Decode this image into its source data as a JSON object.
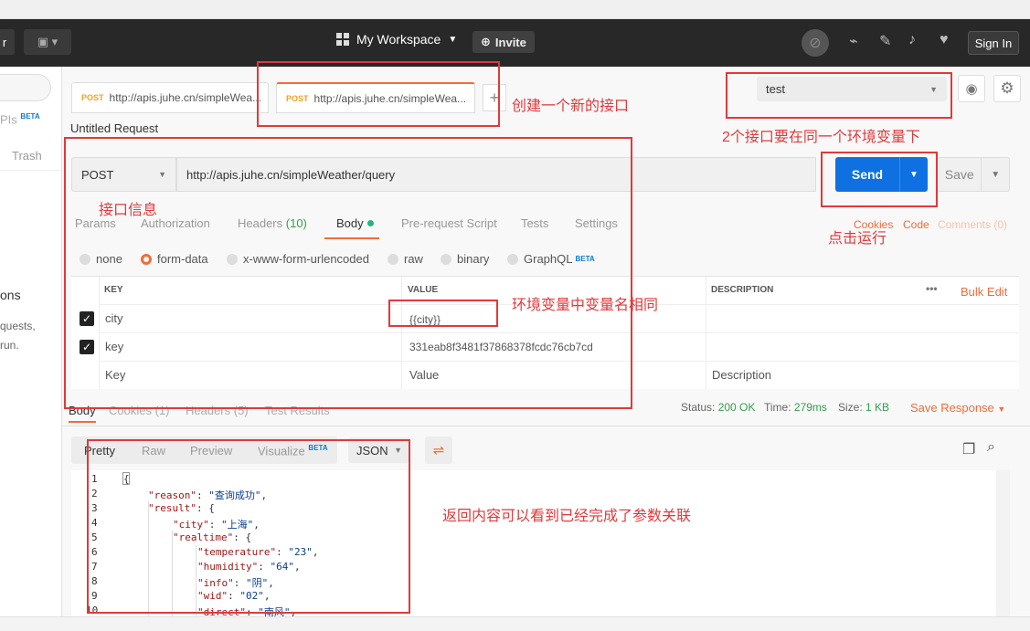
{
  "header": {
    "workspace": "My Workspace",
    "invite": "Invite",
    "sign_in": "Sign In"
  },
  "sidebar": {
    "apis": "PIs",
    "apis_badge": "BETA",
    "trash": "Trash",
    "section_title": "ons",
    "line1": "quests,",
    "line2": "run."
  },
  "tabs": [
    {
      "method": "POST",
      "label": "http://apis.juhe.cn/simpleWea..."
    },
    {
      "method": "POST",
      "label": "http://apis.juhe.cn/simpleWea..."
    }
  ],
  "environment": "test",
  "request": {
    "title": "Untitled Request",
    "method": "POST",
    "url": "http://apis.juhe.cn/simpleWeather/query",
    "send": "Send",
    "save": "Save"
  },
  "request_tabs": {
    "params": "Params",
    "authorization": "Authorization",
    "headers": "Headers",
    "headers_count": "(10)",
    "body": "Body",
    "prerequest": "Pre-request Script",
    "tests": "Tests",
    "settings": "Settings",
    "cookies": "Cookies",
    "code": "Code",
    "comments": "Comments (0)"
  },
  "body_types": {
    "none": "none",
    "form_data": "form-data",
    "urlencoded": "x-www-form-urlencoded",
    "raw": "raw",
    "binary": "binary",
    "graphql": "GraphQL",
    "graphql_badge": "BETA"
  },
  "params_table": {
    "headers": {
      "key": "KEY",
      "value": "VALUE",
      "description": "DESCRIPTION",
      "more": "•••",
      "bulk_edit": "Bulk Edit"
    },
    "rows": [
      {
        "key": "city",
        "value": "{{city}}"
      },
      {
        "key": "key",
        "value": "331eab8f3481f37868378fcdc76cb7cd"
      }
    ],
    "placeholder": {
      "key": "Key",
      "value": "Value",
      "description": "Description"
    }
  },
  "response": {
    "tabs": {
      "body": "Body",
      "cookies": "Cookies (1)",
      "headers": "Headers (5)",
      "test_results": "Test Results"
    },
    "status_label": "Status:",
    "status": "200 OK",
    "time_label": "Time:",
    "time": "279ms",
    "size_label": "Size:",
    "size": "1 KB",
    "save_response": "Save Response",
    "view_tabs": {
      "pretty": "Pretty",
      "raw": "Raw",
      "preview": "Preview",
      "visualize": "Visualize",
      "visualize_badge": "BETA"
    },
    "format": "JSON"
  },
  "code_lines": [
    {
      "n": "1",
      "text": "{"
    },
    {
      "n": "2",
      "key": "\"reason\"",
      "val": "\"查询成功\"",
      "tail": ","
    },
    {
      "n": "3",
      "key": "\"result\"",
      "tail": " {"
    },
    {
      "n": "4",
      "key": "\"city\"",
      "val": "\"上海\"",
      "tail": ","
    },
    {
      "n": "5",
      "key": "\"realtime\"",
      "tail": " {"
    },
    {
      "n": "6",
      "key": "\"temperature\"",
      "val": "\"23\"",
      "tail": ","
    },
    {
      "n": "7",
      "key": "\"humidity\"",
      "val": "\"64\"",
      "tail": ","
    },
    {
      "n": "8",
      "key": "\"info\"",
      "val": "\"阴\"",
      "tail": ","
    },
    {
      "n": "9",
      "key": "\"wid\"",
      "val": "\"02\"",
      "tail": ","
    },
    {
      "n": "10",
      "key": "\"direct\"",
      "val": "\"南风\"",
      "tail": ","
    }
  ],
  "annotations": {
    "new_api": "创建一个新的接口",
    "same_env": "2个接口要在同一个环境变量下",
    "api_info": "接口信息",
    "click_run": "点击运行",
    "same_var": "环境变量中变量名相同",
    "response_note": "返回内容可以看到已经完成了参数关联"
  },
  "colors": {
    "accent": "#f26b3a",
    "send_blue": "#0f71e1",
    "annotation_red": "#e03a3a",
    "status_green": "#33a14a"
  }
}
